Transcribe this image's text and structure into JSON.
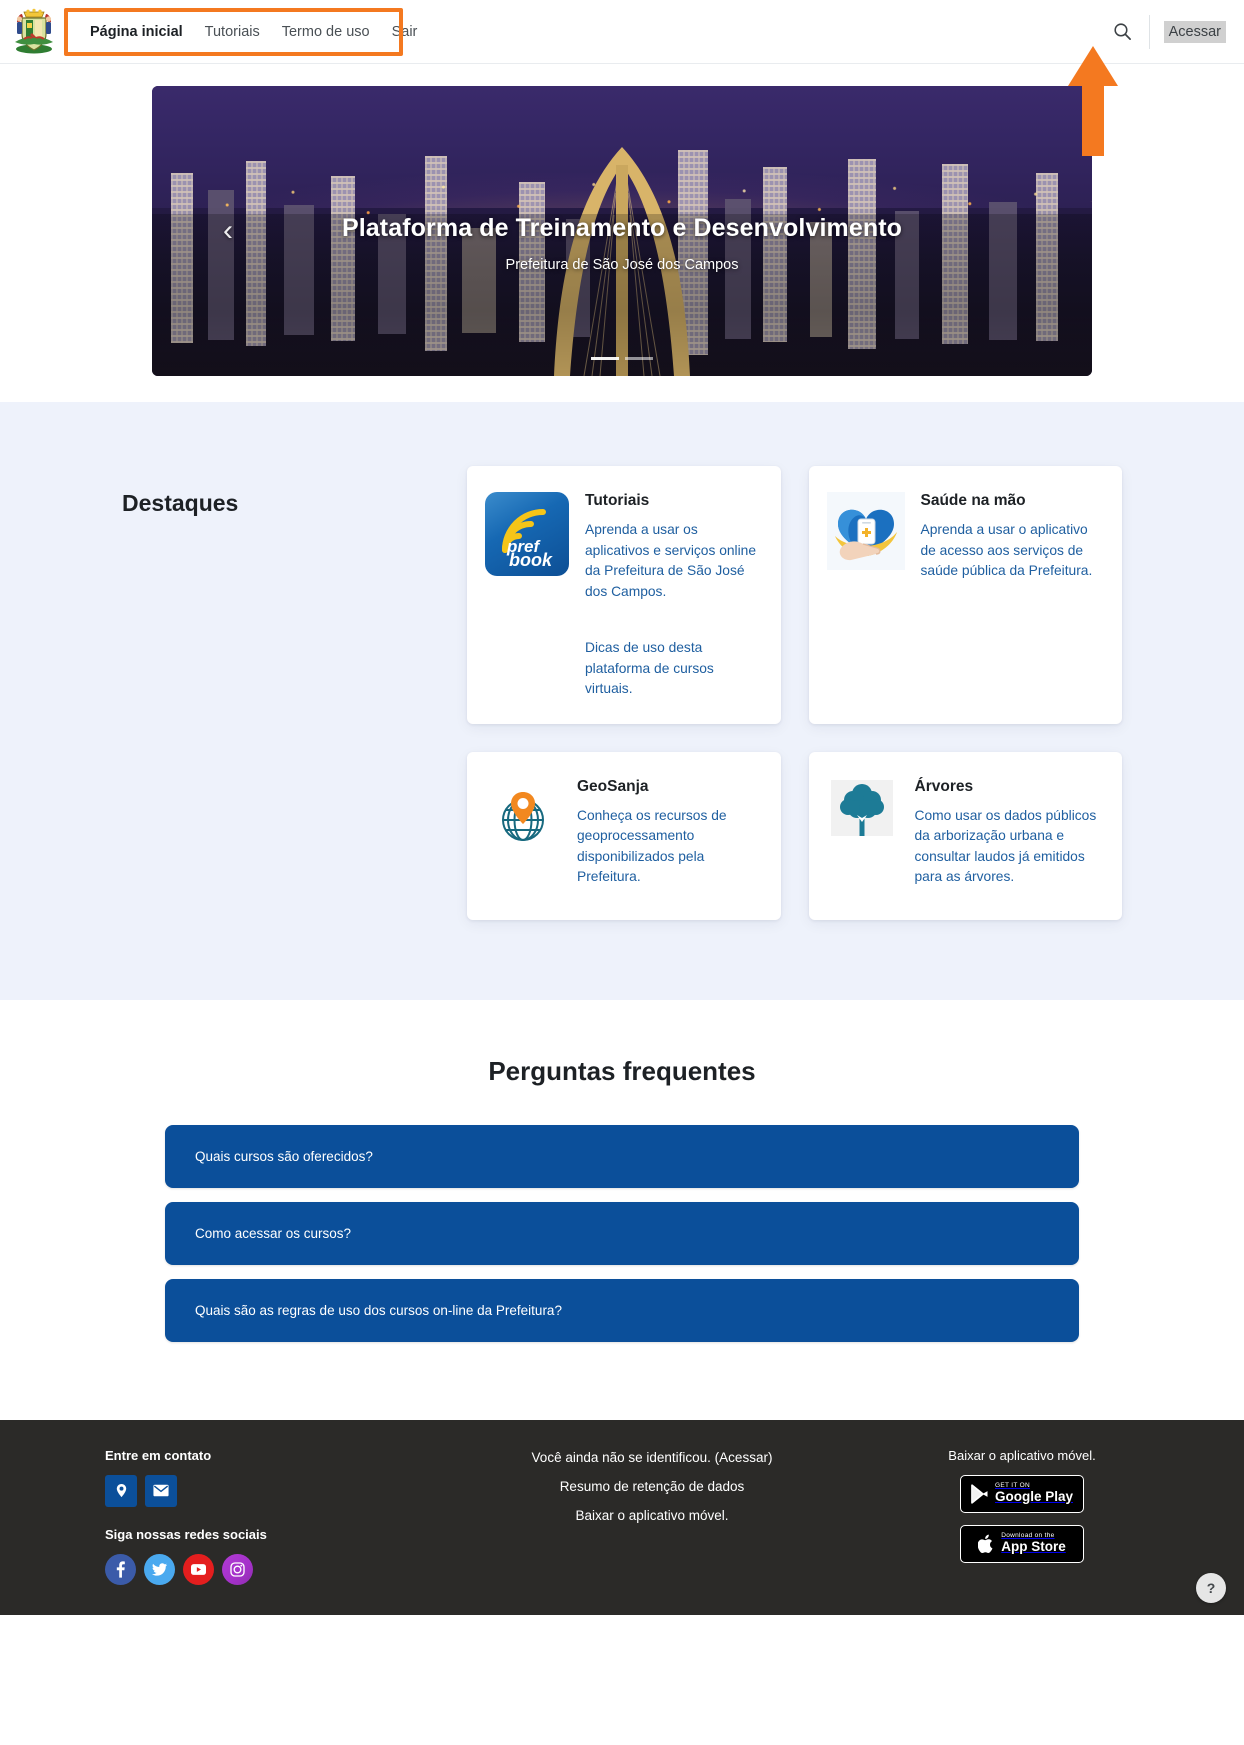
{
  "header": {
    "logo_alt": "Brasão da Prefeitura de São José dos Campos",
    "nav": [
      {
        "label": "Página inicial",
        "active": true
      },
      {
        "label": "Tutoriais",
        "active": false
      },
      {
        "label": "Termo de uso",
        "active": false
      },
      {
        "label": "Sair",
        "active": false
      }
    ],
    "search_label": "Pesquisar",
    "login_label": "Acessar"
  },
  "hero": {
    "title": "Plataforma de Treinamento e Desenvolvimento",
    "subtitle": "Prefeitura de São José dos Campos",
    "prev_label": "‹",
    "next_label": "›",
    "slides": 2,
    "active_slide": 1
  },
  "destaques": {
    "title": "Destaques",
    "cards": [
      {
        "icon": "prefbook-icon",
        "title": "Tutoriais",
        "links": [
          "Aprenda a usar os aplicativos e serviços online da Prefeitura de São José dos Campos.",
          "Dicas de uso desta plataforma de cursos virtuais."
        ]
      },
      {
        "icon": "saude-na-mao-icon",
        "title": "Saúde na mão",
        "links": [
          "Aprenda a usar o aplicativo de acesso aos serviços de saúde pública da Prefeitura."
        ]
      },
      {
        "icon": "geosanja-icon",
        "title": "GeoSanja",
        "links": [
          "Conheça os recursos de geoprocessamento disponibilizados pela Prefeitura."
        ]
      },
      {
        "icon": "arvore-icon",
        "title": "Árvores",
        "links": [
          "Como usar os dados públicos da arborização urbana e consultar laudos já emitidos para as árvores."
        ]
      }
    ]
  },
  "faq": {
    "title": "Perguntas frequentes",
    "items": [
      "Quais cursos são oferecidos?",
      "Como acessar os cursos?",
      "Quais são as regras de uso dos cursos on-line da Prefeitura?"
    ]
  },
  "footer": {
    "contact_heading": "Entre em contato",
    "contact_buttons": [
      "location-pin-icon",
      "envelope-icon"
    ],
    "social_heading": "Siga nossas redes sociais",
    "social": [
      "facebook-icon",
      "twitter-icon",
      "youtube-icon",
      "instagram-icon"
    ],
    "center_lines": [
      "Você ainda não se identificou. (Acessar)",
      "Resumo de retenção de dados",
      "Baixar o aplicativo móvel."
    ],
    "store_heading": "Baixar o aplicativo móvel.",
    "google_play": {
      "small": "GET IT ON",
      "big": "Google Play"
    },
    "app_store": {
      "small": "Download on the",
      "big": "App Store"
    },
    "help_label": "?"
  },
  "annotations": {
    "rect_color": "#f47920",
    "arrow_color": "#f47920",
    "highlight_color": "#d0d0d0"
  }
}
